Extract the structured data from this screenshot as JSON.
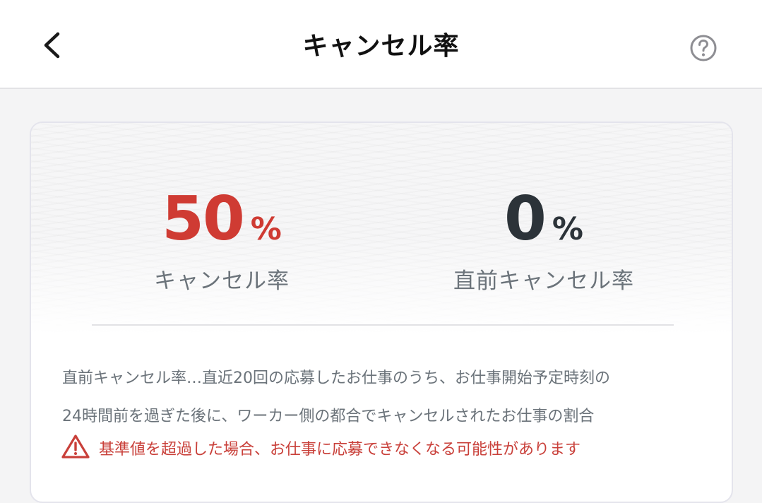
{
  "header": {
    "title": "キャンセル率",
    "back_icon": "chevron-left-icon",
    "help_icon": "question-circle-icon"
  },
  "stats": {
    "cancel_rate": {
      "value": "50",
      "unit": "%",
      "label": "キャンセル率",
      "color": "#cf3b33"
    },
    "last_minute_cancel_rate": {
      "value": "0",
      "unit": "%",
      "label": "直前キャンセル率",
      "color": "#2c3339"
    }
  },
  "description": {
    "line1": "直前キャンセル率…直近20回の応募したお仕事のうち、お仕事開始予定時刻の",
    "line2": "24時間前を過ぎた後に、ワーカー側の都合でキャンセルされたお仕事の割合"
  },
  "warning": {
    "icon": "warning-triangle-icon",
    "text": "基準値を超過した場合、お仕事に応募できなくなる可能性があります",
    "color": "#c9403a"
  }
}
